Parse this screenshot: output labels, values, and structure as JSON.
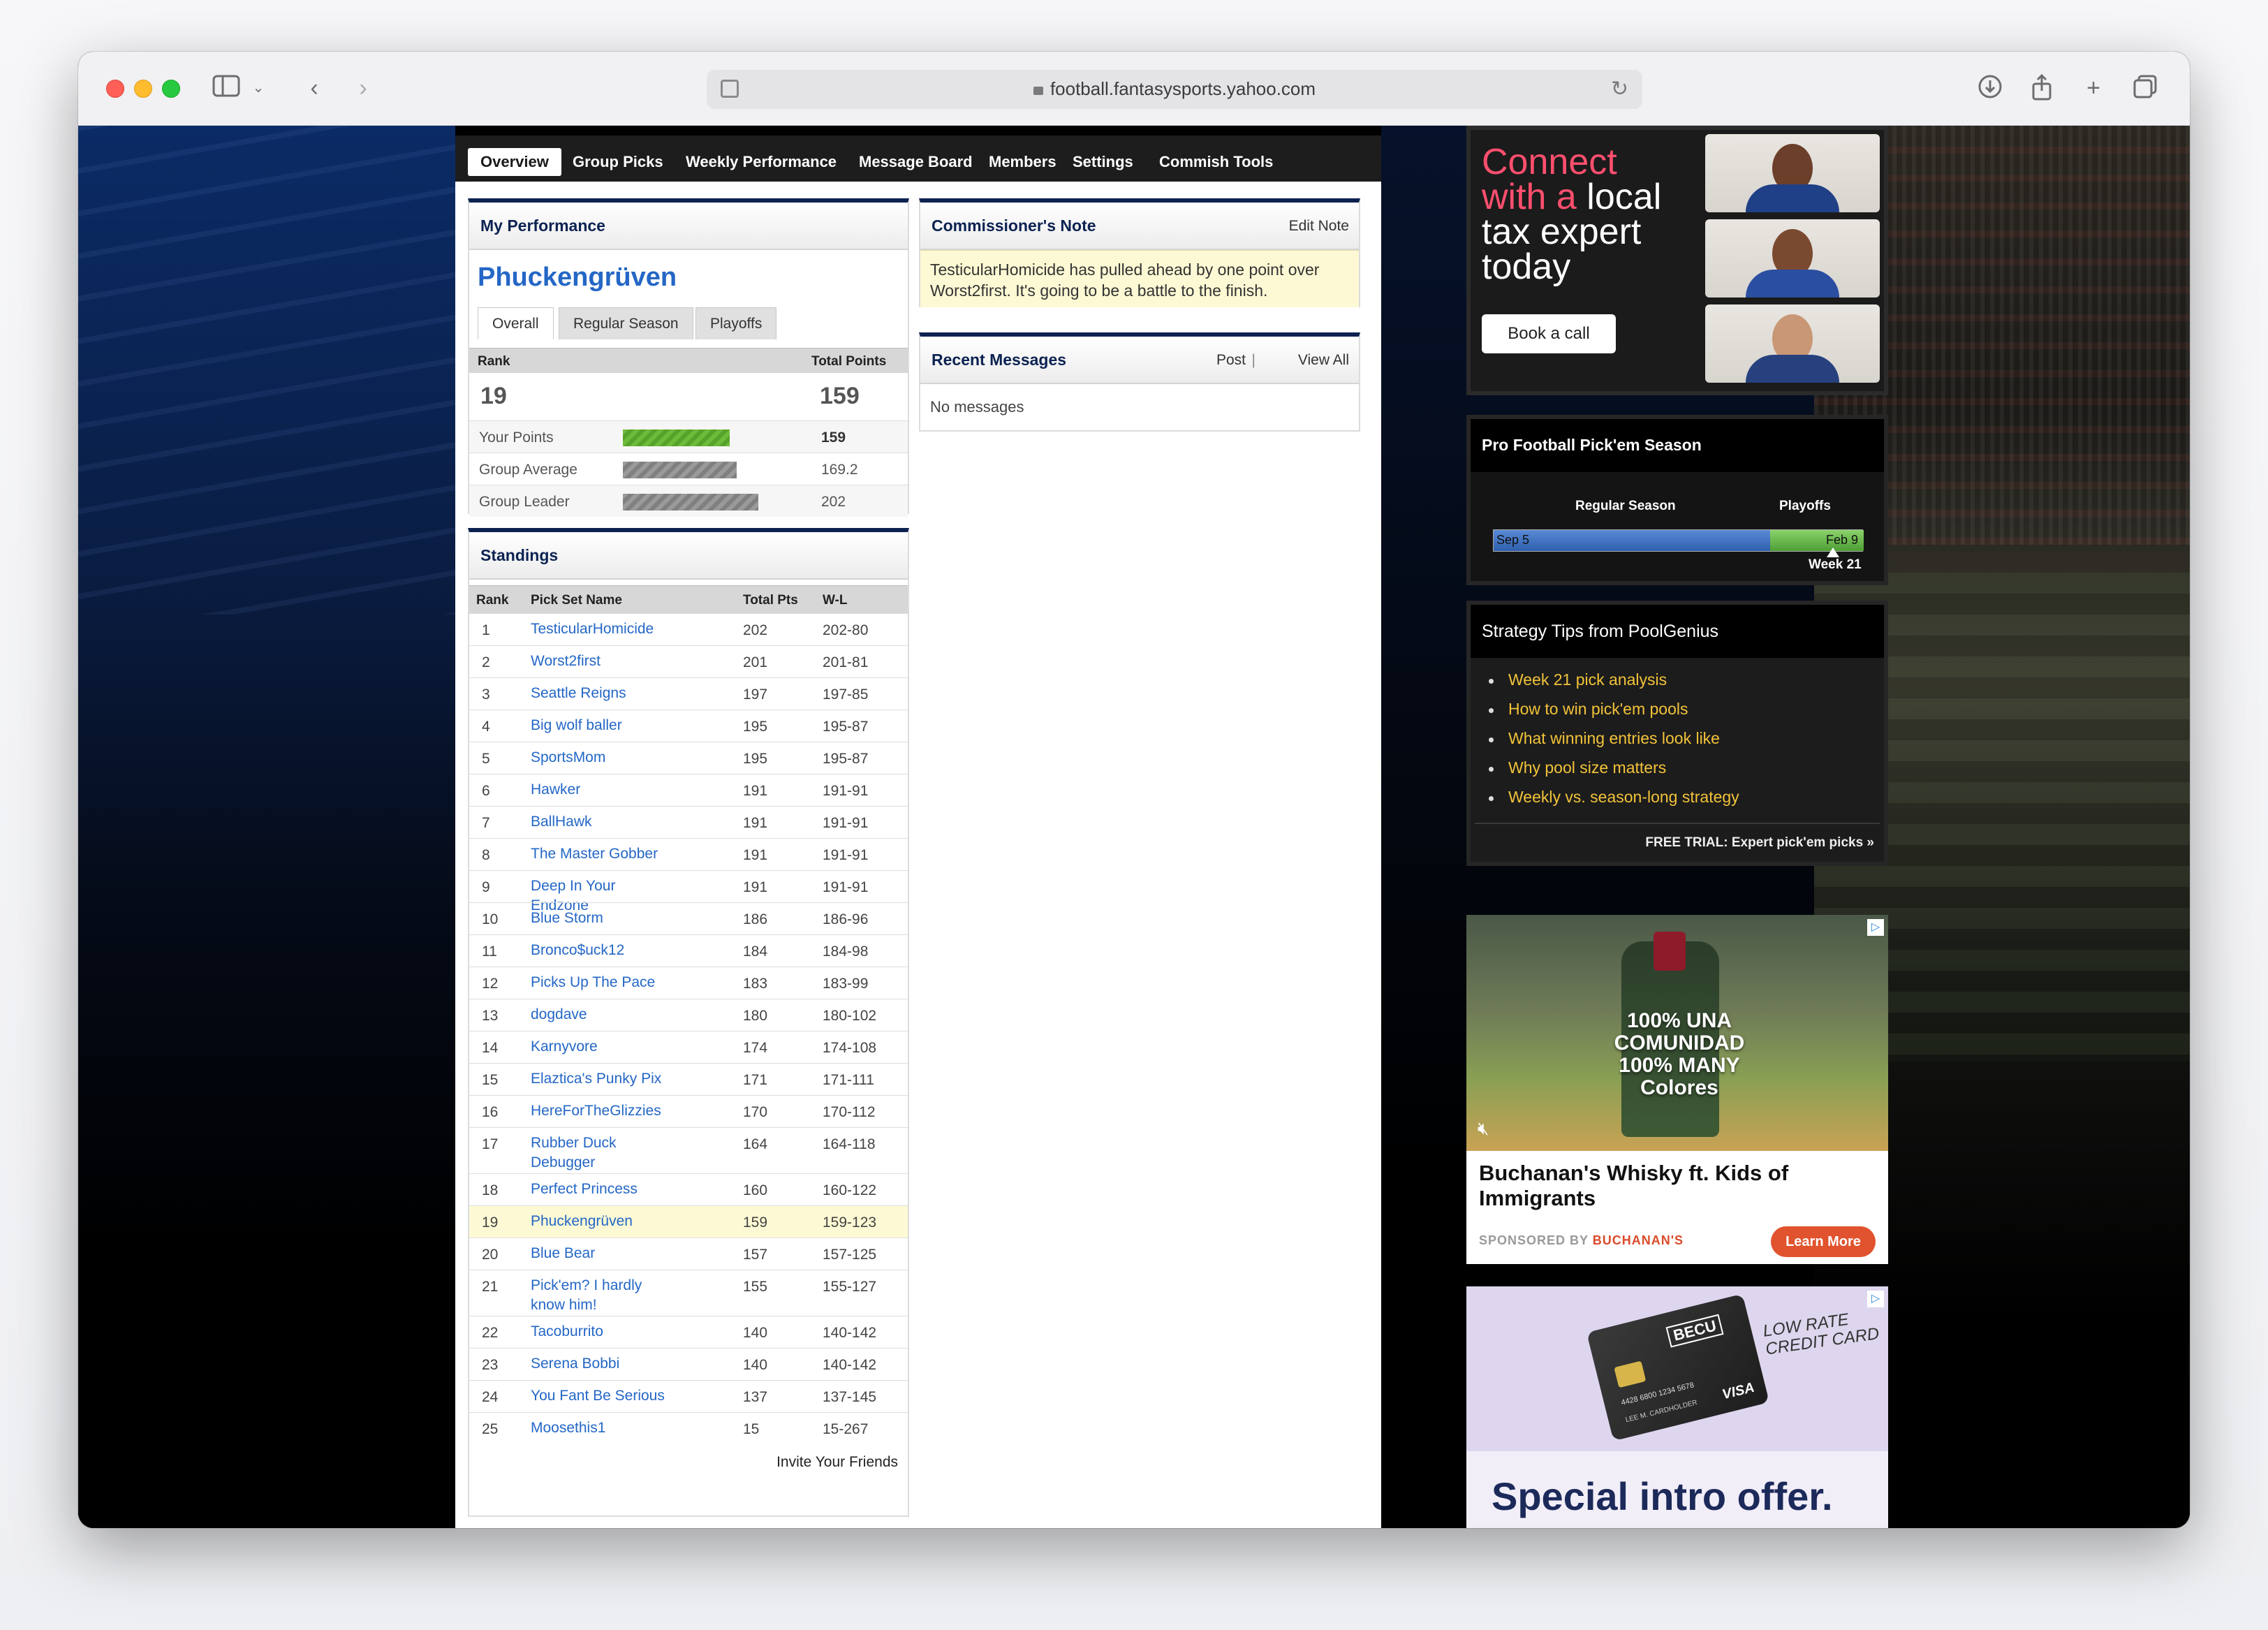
{
  "browser": {
    "url": "football.fantasysports.yahoo.com"
  },
  "nav": {
    "items": [
      "Overview",
      "Group Picks",
      "Weekly Performance",
      "Message Board",
      "Members",
      "Settings",
      "Commish Tools"
    ]
  },
  "performance": {
    "title": "My Performance",
    "team_name": "Phuckengrüven",
    "tabs": [
      "Overall",
      "Regular Season",
      "Playoffs"
    ],
    "rank_label": "Rank",
    "total_points_label": "Total Points",
    "rank": "19",
    "total_points": "159",
    "rows": [
      {
        "label": "Your Points",
        "value": "159",
        "bar_fraction": 0.787
      },
      {
        "label": "Group Average",
        "value": "169.2",
        "bar_fraction": 0.838
      },
      {
        "label": "Group Leader",
        "value": "202",
        "bar_fraction": 1.0
      }
    ]
  },
  "standings": {
    "title": "Standings",
    "headers": {
      "rank": "Rank",
      "name": "Pick Set Name",
      "pts": "Total Pts",
      "wl": "W-L"
    },
    "rows": [
      {
        "rank": "1",
        "name": "TesticularHomicide",
        "pts": "202",
        "wl": "202-80"
      },
      {
        "rank": "2",
        "name": "Worst2first",
        "pts": "201",
        "wl": "201-81"
      },
      {
        "rank": "3",
        "name": "Seattle Reigns",
        "pts": "197",
        "wl": "197-85"
      },
      {
        "rank": "4",
        "name": "Big wolf baller",
        "pts": "195",
        "wl": "195-87"
      },
      {
        "rank": "5",
        "name": "SportsMom",
        "pts": "195",
        "wl": "195-87"
      },
      {
        "rank": "6",
        "name": "Hawker",
        "pts": "191",
        "wl": "191-91"
      },
      {
        "rank": "7",
        "name": "BallHawk",
        "pts": "191",
        "wl": "191-91"
      },
      {
        "rank": "8",
        "name": "The Master Gobber",
        "pts": "191",
        "wl": "191-91"
      },
      {
        "rank": "9",
        "name": "Deep In Your Endzone",
        "pts": "191",
        "wl": "191-91"
      },
      {
        "rank": "10",
        "name": "Blue Storm",
        "pts": "186",
        "wl": "186-96"
      },
      {
        "rank": "11",
        "name": "Bronco$uck12",
        "pts": "184",
        "wl": "184-98"
      },
      {
        "rank": "12",
        "name": "Picks Up The Pace",
        "pts": "183",
        "wl": "183-99"
      },
      {
        "rank": "13",
        "name": "dogdave",
        "pts": "180",
        "wl": "180-102"
      },
      {
        "rank": "14",
        "name": "Karnyvore",
        "pts": "174",
        "wl": "174-108"
      },
      {
        "rank": "15",
        "name": "Elaztica's Punky Pix",
        "pts": "171",
        "wl": "171-111"
      },
      {
        "rank": "16",
        "name": "HereForTheGlizzies",
        "pts": "170",
        "wl": "170-112"
      },
      {
        "rank": "17",
        "name": "Rubber Duck Debugger",
        "pts": "164",
        "wl": "164-118"
      },
      {
        "rank": "18",
        "name": "Perfect Princess",
        "pts": "160",
        "wl": "160-122"
      },
      {
        "rank": "19",
        "name": "Phuckengrüven",
        "pts": "159",
        "wl": "159-123"
      },
      {
        "rank": "20",
        "name": "Blue Bear",
        "pts": "157",
        "wl": "157-125"
      },
      {
        "rank": "21",
        "name": "Pick'em? I hardly know him!",
        "pts": "155",
        "wl": "155-127"
      },
      {
        "rank": "22",
        "name": "Tacoburrito",
        "pts": "140",
        "wl": "140-142"
      },
      {
        "rank": "23",
        "name": "Serena Bobbi",
        "pts": "140",
        "wl": "140-142"
      },
      {
        "rank": "24",
        "name": "You Fant Be Serious",
        "pts": "137",
        "wl": "137-145"
      },
      {
        "rank": "25",
        "name": "Moosethis1",
        "pts": "15",
        "wl": "15-267"
      }
    ],
    "invite": "Invite Your Friends"
  },
  "commissioner": {
    "title": "Commissioner's Note",
    "edit": "Edit Note",
    "note": "TesticularHomicide has pulled ahead by one point over Worst2first. It's going to be a battle to the finish."
  },
  "messages": {
    "title": "Recent Messages",
    "post": "Post",
    "view_all": "View All",
    "empty": "No messages"
  },
  "ad_tax": {
    "line1_pink": "Connect",
    "line2_pink": "with a",
    "line2_white": "local",
    "line3": "tax expert",
    "line4": "today",
    "button": "Book a call"
  },
  "pickem": {
    "title": "Pro Football Pick'em Season",
    "regular": "Regular Season",
    "playoffs": "Playoffs",
    "start": "Sep 5",
    "end": "Feb 9",
    "week": "Week 21"
  },
  "tips": {
    "title": "Strategy Tips from PoolGenius",
    "items": [
      "Week 21 pick analysis",
      "How to win pick'em pools",
      "What winning entries look like",
      "Why pool size matters",
      "Weekly vs. season-long strategy"
    ],
    "footer": "FREE TRIAL: Expert pick'em picks »"
  },
  "ad_whisky": {
    "overlay": "100% UNA COMUNIDAD 100% MANY Colores",
    "title": "Buchanan's Whisky ft. Kids of Immigrants",
    "sponsored": "SPONSORED BY",
    "brand": "BUCHANAN'S",
    "button": "Learn More"
  },
  "ad_becu": {
    "logo": "BECU",
    "tagline": "LOW RATE CREDIT CARD",
    "visa": "VISA",
    "card_number": "4428 6800 1234 5678",
    "card_holder": "LEE M. CARDHOLDER",
    "offer": "Special intro offer."
  },
  "colors": {
    "navy": "#0c2251",
    "link": "#2467c6",
    "highlight": "#fdf9d4",
    "tip": "#f2c33a"
  }
}
